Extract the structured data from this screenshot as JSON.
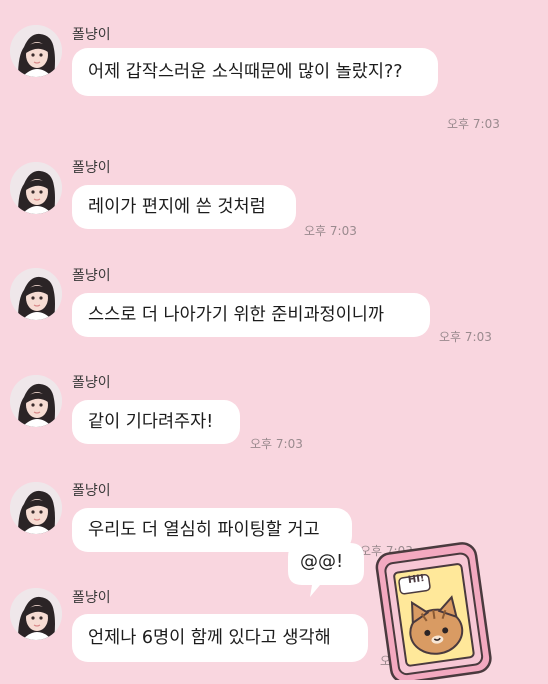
{
  "sender_name": "폴냥이",
  "messages": [
    {
      "sender": "폴냥이",
      "text": "어제 갑작스러운 소식때문에 많이 놀랐지??",
      "time": "오후 7:03"
    },
    {
      "sender": "폴냥이",
      "text": "레이가 편지에 쓴 것처럼",
      "time": "오후 7:03"
    },
    {
      "sender": "폴냥이",
      "text": "스스로 더 나아가기 위한 준비과정이니까",
      "time": "오후 7:03"
    },
    {
      "sender": "폴냥이",
      "text": "같이 기다려주자!",
      "time": "오후 7:03"
    },
    {
      "sender": "폴냥이",
      "text": "우리도 더 열심히 파이팅할 거고",
      "time": "오후 7:03"
    },
    {
      "sender": "폴냥이",
      "text": "언제나 6명이 함께 있다고 생각해",
      "time": "오후 7:0"
    }
  ],
  "sticker": {
    "speech": "@@!",
    "screen_text": "HI!"
  },
  "colors": {
    "background": "#f9d6df",
    "bubble": "#ffffff",
    "phone": "#f3a9c0"
  }
}
